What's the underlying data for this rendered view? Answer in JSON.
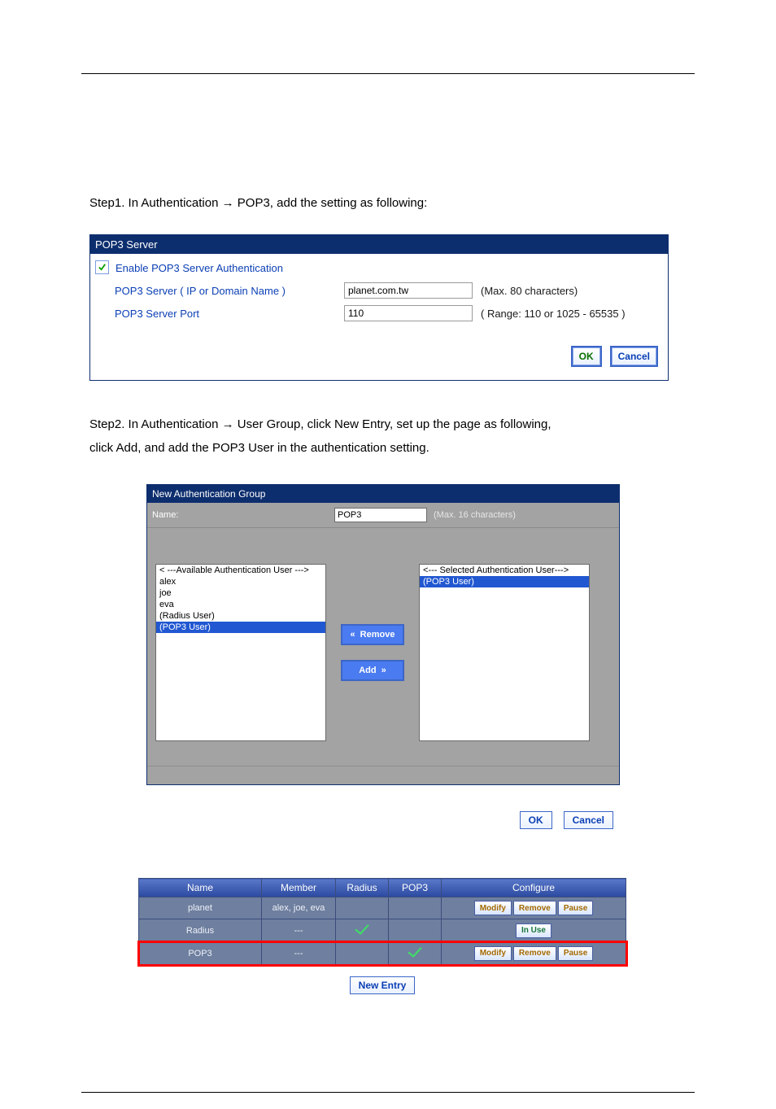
{
  "step1_text": "Step1. In Authentication → POP3, add the setting as following:",
  "panel1": {
    "title": "POP3 Server",
    "enable_label": "Enable POP3 Server Authentication",
    "row1_label": "POP3 Server ( IP or Domain Name )",
    "row1_value": "planet.com.tw",
    "row1_hint": "(Max. 80 characters)",
    "row2_label": "POP3 Server Port",
    "row2_value": "110",
    "row2_hint": "( Range: 110 or 1025 - 65535 )",
    "ok": "OK",
    "cancel": "Cancel"
  },
  "step2_line1": "Step2. In Authentication → User Group, click New Entry, set up the page as following,",
  "step2_line2": "click Add, and add the POP3 User in the authentication setting.",
  "panel2": {
    "title": "New Authentication Group",
    "name_label": "Name:",
    "name_value": "POP3",
    "name_hint": "(Max. 16 characters)",
    "avail_header": "< ---Available Authentication User --->",
    "avail": [
      "alex",
      "joe",
      "eva",
      "(Radius User)",
      "(POP3 User)"
    ],
    "avail_selected": "(POP3 User)",
    "sel_header": "<--- Selected Authentication User--->",
    "sel": [
      "(POP3 User)"
    ],
    "sel_selected": "(POP3 User)",
    "remove": "Remove",
    "add": "Add",
    "ok": "OK",
    "cancel": "Cancel"
  },
  "table": {
    "headers": [
      "Name",
      "Member",
      "Radius",
      "POP3",
      "Configure"
    ],
    "rows": [
      {
        "name": "planet",
        "member": "alex, joe, eva",
        "radius": false,
        "pop3": false,
        "conf": "mrp"
      },
      {
        "name": "Radius",
        "member": "---",
        "radius": true,
        "pop3": false,
        "conf": "inuse"
      },
      {
        "name": "POP3",
        "member": "---",
        "radius": false,
        "pop3": true,
        "conf": "mrp"
      }
    ],
    "modify": "Modify",
    "remove": "Remove",
    "pause": "Pause",
    "inuse": "In Use",
    "new_entry": "New Entry"
  }
}
